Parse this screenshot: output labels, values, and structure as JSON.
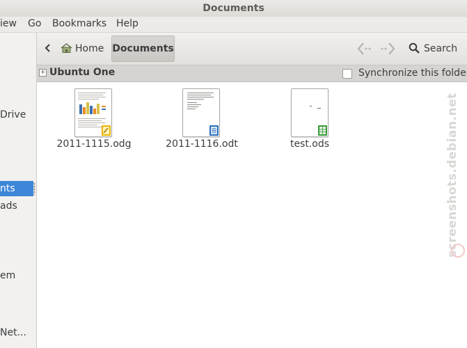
{
  "window": {
    "title": "Documents"
  },
  "menubar": {
    "items": [
      "iew",
      "Go",
      "Bookmarks",
      "Help"
    ]
  },
  "sidebar": {
    "items": [
      {
        "label": "Drive",
        "selected": false
      },
      {
        "label": "nts",
        "selected": true
      },
      {
        "label": "ads",
        "selected": false
      },
      {
        "label": "em",
        "selected": false
      },
      {
        "label": "Net...",
        "selected": false
      }
    ]
  },
  "toolbar": {
    "home_label": "Home",
    "current_label": "Documents",
    "search_label": "Search"
  },
  "infobar": {
    "title": "Ubuntu One",
    "expander_glyph": "+",
    "sync_label": "Synchronize this folder",
    "sync_checked": false
  },
  "files": [
    {
      "name": "2011-1115.odg",
      "type": "drawing",
      "badge_color": "#e8b400"
    },
    {
      "name": "2011-1116.odt",
      "type": "text",
      "badge_color": "#2a6fbd"
    },
    {
      "name": "test.ods",
      "type": "spreadsheet",
      "badge_color": "#3a9a3a"
    }
  ],
  "watermark": {
    "text": "screenshots.debian.net"
  }
}
